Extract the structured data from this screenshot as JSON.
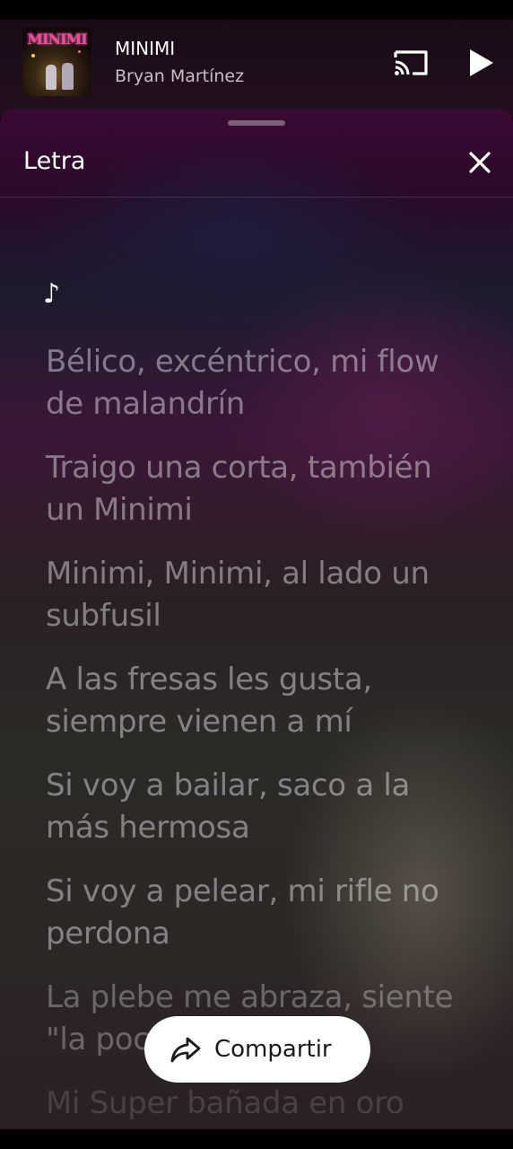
{
  "mini_player": {
    "cover_text": "MINIMI",
    "title": "MINIMI",
    "artist": "Bryan Martínez",
    "icons": {
      "cast": "cast-icon",
      "play": "play-icon"
    }
  },
  "lyrics_sheet": {
    "title": "Letra",
    "close_icon": "close-icon",
    "note": "♪",
    "lines": [
      "Bélico, excéntrico, mi flow de malandrín",
      "Traigo una corta, también un Minimi",
      "Minimi, Minimi, al lado un subfusil",
      "A las fresas les gusta, siempre vienen a mí",
      "Si voy a bailar, saco a la más hermosa",
      "Si voy a pelear, mi rifle no perdona",
      "La plebe me abraza, siente \"la poca\"",
      "Mi Super bañada en oro"
    ]
  },
  "share_button": {
    "label": "Compartir",
    "icon": "share-icon"
  },
  "colors": {
    "accent": "#3a0a33",
    "button_bg": "#ffffff"
  }
}
